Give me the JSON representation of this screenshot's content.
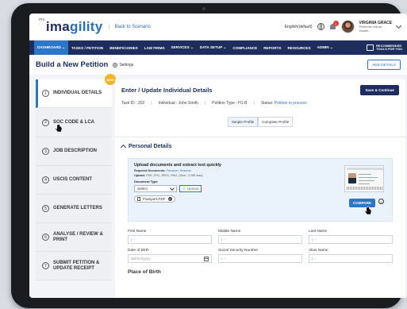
{
  "app": {
    "brand_prefix": "my",
    "brand": "imagility",
    "back_link": "Back to Scenario"
  },
  "topbar": {
    "language": "English(default)",
    "notification_count": "1",
    "user_name": "VIRGINIA GRACE",
    "user_role": "Petitioner Admin",
    "user_company": "Insidel..."
  },
  "nav": {
    "items": [
      "DASHBOARD ⌄",
      "TASKS / PETITION",
      "BENEFICIARIES",
      "LAW FIRMS",
      "SERVICES ⌄",
      "DATA SETUP ⌄",
      "COMPLIANCE",
      "REPORTS",
      "RESOURCES",
      "ADMIN ⌄"
    ],
    "active_index": 0,
    "reco_line1": "RECOMMENDED",
    "reco_line2": "TOOLS FOR YOU"
  },
  "page": {
    "title": "Build a New Petition",
    "settings": "Settings",
    "add_details": "ADD DETAILS"
  },
  "sidebar": {
    "new_badge": "NEW",
    "steps": [
      {
        "num": "1",
        "label": "INDIVIDUAL DETAILS"
      },
      {
        "num": "2",
        "label": "SOC CODE & LCA"
      },
      {
        "num": "3",
        "label": "JOB DESCRIPTION"
      },
      {
        "num": "4",
        "label": "USCIS CONTENT"
      },
      {
        "num": "5",
        "label": "GENERATE LETTERS"
      },
      {
        "num": "6",
        "label": "ANALYSE / REVIEW & PRINT"
      },
      {
        "num": "7",
        "label": "SUBMIT PETITION & UPDATE RECEIPT"
      }
    ],
    "active_index": 0
  },
  "main": {
    "title": "Enter / Update Individual Details",
    "save_button": "Save & Continue",
    "task_id": "Task ID : 202",
    "individual": "Individual : John Smith",
    "petition_type": "Petition Type : H1-B",
    "status_label": "Status:",
    "status_value": "Petition in process",
    "toggle_simple": "Simple Profile",
    "toggle_complete": "Complete Profile",
    "section_title": "Personal Details"
  },
  "upload": {
    "title": "Upload documents and extract text quickly",
    "required_label": "Required Documents:",
    "required_value": "Passport, Resume",
    "upload_label": "Upload:",
    "upload_value": "PDF, JPG, JPEG, PNG, (Size : 2 MB max)",
    "doc_type_label": "Document Type",
    "select_value": "Select",
    "upload_button": "Upload",
    "file_chip": "Passport.PDF",
    "compare_button": "COMPARE",
    "info": "i"
  },
  "form": {
    "first_name_label": "First Name",
    "middle_name_label": "Middle Name",
    "last_name_label": "Last Name",
    "dob_label": "Date of Birth",
    "ssn_label": "Social Security Number",
    "alias_label": "Alias Name",
    "placeholder_dash": "| --",
    "dob_placeholder": "dd/mm/yyyy",
    "place_of_birth": "Place of Birth"
  }
}
